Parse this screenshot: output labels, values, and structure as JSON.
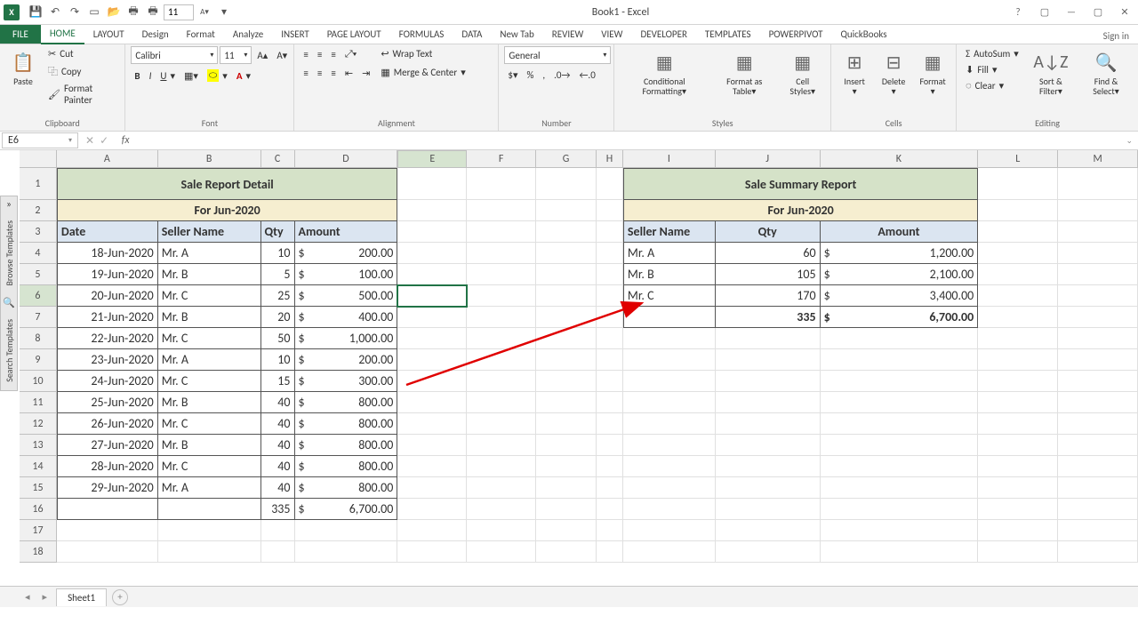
{
  "title": "Book1 - Excel",
  "qat_font_size": "11",
  "tabs": [
    "FILE",
    "HOME",
    "LAYOUT",
    "Design",
    "Format",
    "Analyze",
    "INSERT",
    "PAGE LAYOUT",
    "FORMULAS",
    "DATA",
    "New Tab",
    "REVIEW",
    "VIEW",
    "DEVELOPER",
    "TEMPLATES",
    "POWERPIVOT",
    "QuickBooks"
  ],
  "active_tab": "HOME",
  "signin": "Sign in",
  "clipboard": {
    "label": "Clipboard",
    "cut": "Cut",
    "copy": "Copy",
    "painter": "Format Painter",
    "paste": "Paste"
  },
  "font": {
    "label": "Font",
    "name": "Calibri",
    "size": "11"
  },
  "alignment": {
    "label": "Alignment",
    "wrap": "Wrap Text",
    "merge": "Merge & Center"
  },
  "number": {
    "label": "Number",
    "format": "General"
  },
  "styles": {
    "label": "Styles",
    "cond": "Conditional Formatting",
    "table": "Format as Table",
    "cell": "Cell Styles"
  },
  "cells": {
    "label": "Cells",
    "insert": "Insert",
    "delete": "Delete",
    "format": "Format"
  },
  "editing": {
    "label": "Editing",
    "autosum": "AutoSum",
    "fill": "Fill",
    "clear": "Clear",
    "sort": "Sort & Filter",
    "find": "Find & Select"
  },
  "namebox": "E6",
  "side_panel": {
    "browse": "Browse Templates",
    "search": "Search Templates"
  },
  "columns": [
    "A",
    "B",
    "C",
    "D",
    "E",
    "F",
    "G",
    "H",
    "I",
    "J",
    "K",
    "L",
    "M"
  ],
  "col_widths": {
    "A": 114,
    "B": 116,
    "C": 38,
    "D": 116,
    "E": 78,
    "F": 78,
    "G": 68,
    "H": 30,
    "I": 104,
    "J": 118,
    "K": 178,
    "L": 90,
    "M": 90
  },
  "detail": {
    "title": "Sale Report Detail",
    "subtitle": "For Jun-2020",
    "headers": {
      "date": "Date",
      "seller": "Seller Name",
      "qty": "Qty",
      "amount": "Amount"
    },
    "rows": [
      {
        "date": "18-Jun-2020",
        "seller": "Mr. A",
        "qty": "10",
        "amount": "200.00"
      },
      {
        "date": "19-Jun-2020",
        "seller": "Mr. B",
        "qty": "5",
        "amount": "100.00"
      },
      {
        "date": "20-Jun-2020",
        "seller": "Mr. C",
        "qty": "25",
        "amount": "500.00"
      },
      {
        "date": "21-Jun-2020",
        "seller": "Mr. B",
        "qty": "20",
        "amount": "400.00"
      },
      {
        "date": "22-Jun-2020",
        "seller": "Mr. C",
        "qty": "50",
        "amount": "1,000.00"
      },
      {
        "date": "23-Jun-2020",
        "seller": "Mr. A",
        "qty": "10",
        "amount": "200.00"
      },
      {
        "date": "24-Jun-2020",
        "seller": "Mr. C",
        "qty": "15",
        "amount": "300.00"
      },
      {
        "date": "25-Jun-2020",
        "seller": "Mr. B",
        "qty": "40",
        "amount": "800.00"
      },
      {
        "date": "26-Jun-2020",
        "seller": "Mr. C",
        "qty": "40",
        "amount": "800.00"
      },
      {
        "date": "27-Jun-2020",
        "seller": "Mr. B",
        "qty": "40",
        "amount": "800.00"
      },
      {
        "date": "28-Jun-2020",
        "seller": "Mr. C",
        "qty": "40",
        "amount": "800.00"
      },
      {
        "date": "29-Jun-2020",
        "seller": "Mr. A",
        "qty": "40",
        "amount": "800.00"
      }
    ],
    "total_qty": "335",
    "total_amount": "6,700.00"
  },
  "summary": {
    "title": "Sale Summary Report",
    "subtitle": "For Jun-2020",
    "headers": {
      "seller": "Seller Name",
      "qty": "Qty",
      "amount": "Amount"
    },
    "rows": [
      {
        "seller": "Mr. A",
        "qty": "60",
        "amount": "1,200.00"
      },
      {
        "seller": "Mr. B",
        "qty": "105",
        "amount": "2,100.00"
      },
      {
        "seller": "Mr. C",
        "qty": "170",
        "amount": "3,400.00"
      }
    ],
    "total_qty": "335",
    "total_amount": "6,700.00"
  },
  "sheet_tab": "Sheet1",
  "chart_data": {
    "type": "table",
    "title": "Sale Summary Report For Jun-2020",
    "categories": [
      "Mr. A",
      "Mr. B",
      "Mr. C"
    ],
    "series": [
      {
        "name": "Qty",
        "values": [
          60,
          105,
          170
        ]
      },
      {
        "name": "Amount",
        "values": [
          1200,
          2100,
          3400
        ]
      }
    ],
    "totals": {
      "Qty": 335,
      "Amount": 6700
    }
  }
}
